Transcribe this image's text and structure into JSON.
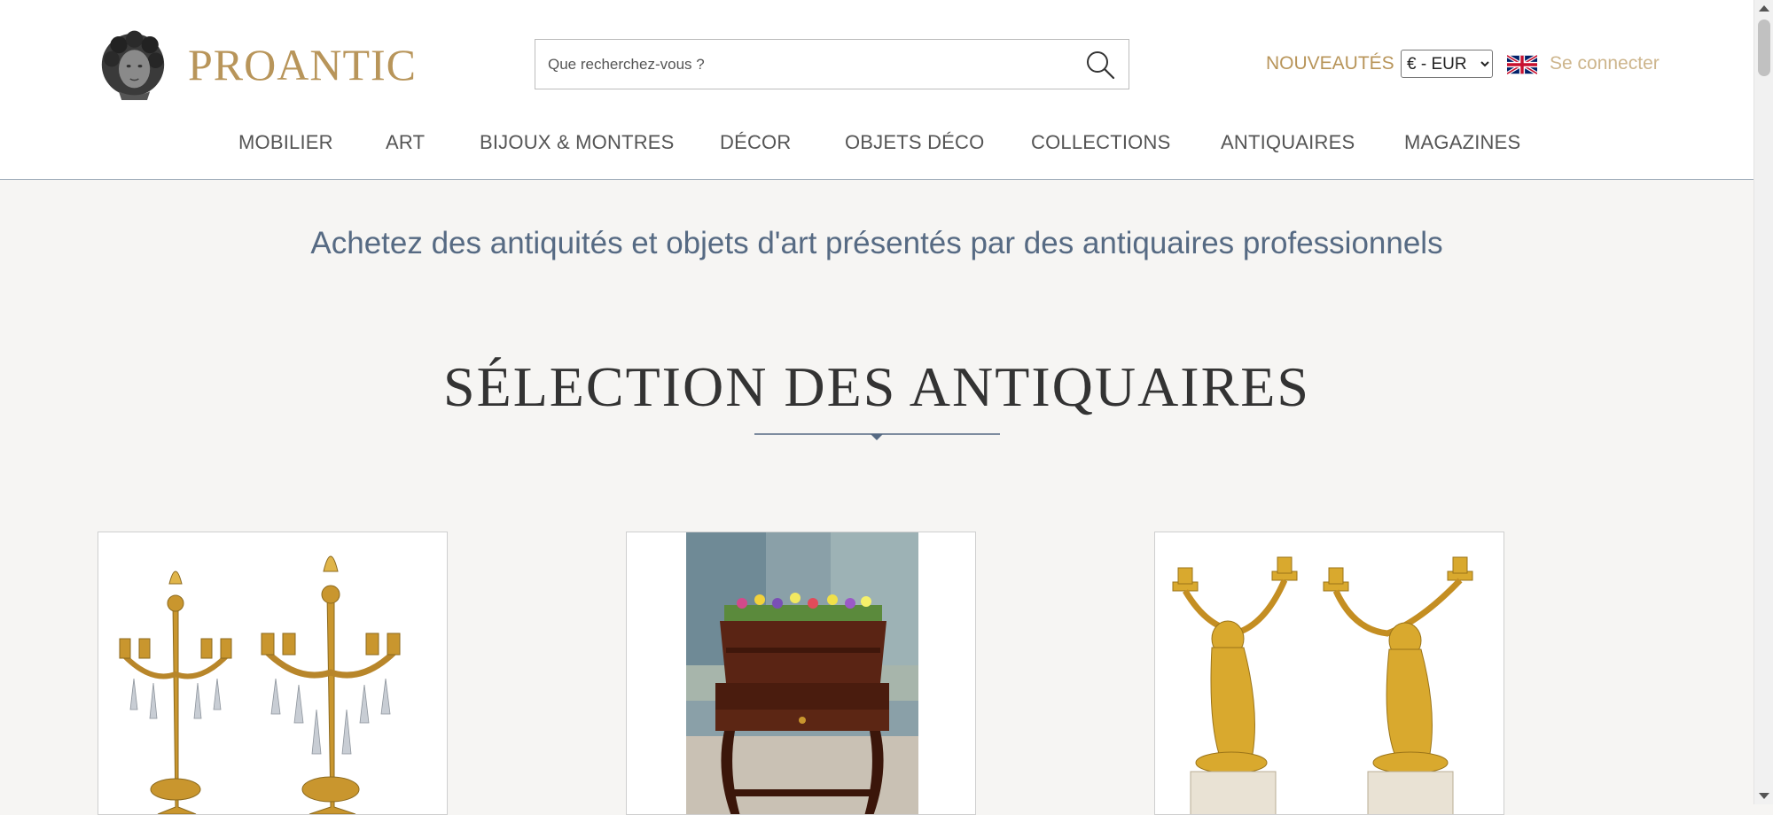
{
  "header": {
    "logo_text": "PROANTIC",
    "search_placeholder": "Que recherchez-vous ?",
    "nouveautes_label": "NOUVEAUTÉS",
    "currency_selected": "€ - EUR",
    "login_label": "Se connecter",
    "accent_color": "#b8955a"
  },
  "nav": {
    "items": [
      "MOBILIER",
      "ART",
      "BIJOUX & MONTRES",
      "DÉCOR",
      "OBJETS DÉCO",
      "COLLECTIONS",
      "ANTIQUAIRES",
      "MAGAZINES"
    ]
  },
  "main": {
    "tagline": "Achetez des antiquités et objets d'art présentés par des antiquaires professionnels",
    "section_title": "SÉLECTION DES ANTIQUAIRES",
    "products": [
      {
        "image": "gilt-bronze-candelabra-pair"
      },
      {
        "image": "mahogany-jardiniere-table"
      },
      {
        "image": "gilt-bronze-cherub-candlesticks"
      }
    ]
  }
}
